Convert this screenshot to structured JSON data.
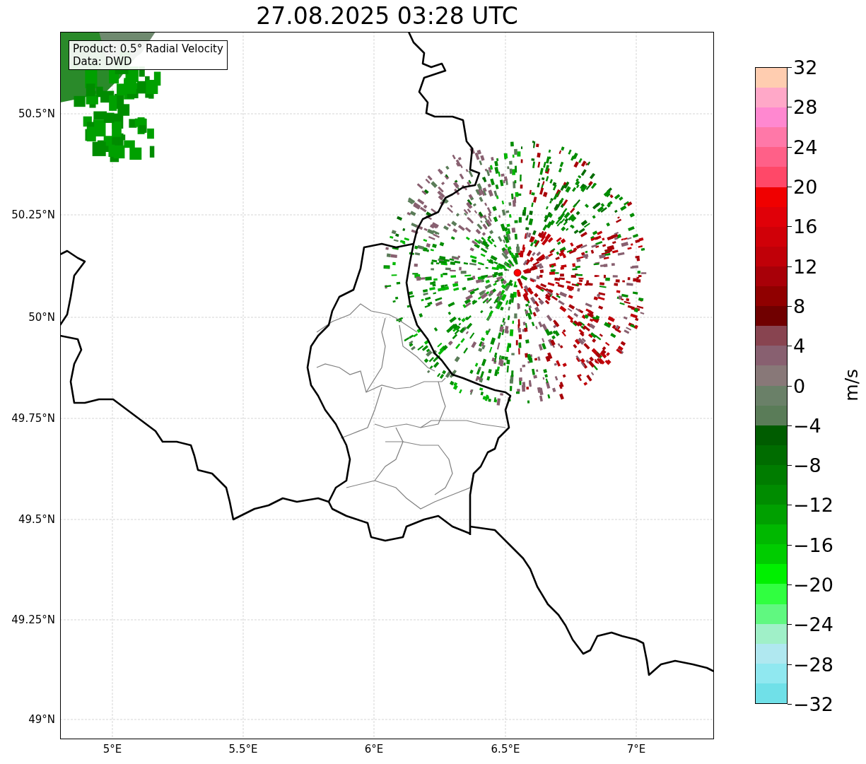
{
  "title": "27.08.2025 03:28 UTC",
  "info_box": {
    "lines": [
      "Product: 0.5° Radial Velocity",
      "Data: DWD"
    ]
  },
  "x_ticks": [
    "5°E",
    "5.5°E",
    "6°E",
    "6.5°E",
    "7°E"
  ],
  "y_ticks": [
    "50.5°N",
    "50.25°N",
    "50°N",
    "49.75°N",
    "49.5°N",
    "49.25°N",
    "49°N"
  ],
  "colorbar": {
    "label": "m/s",
    "ticks": [
      "32",
      "28",
      "24",
      "20",
      "16",
      "12",
      "8",
      "4",
      "0",
      "−4",
      "−8",
      "−12",
      "−16",
      "−20",
      "−24",
      "−28",
      "−32"
    ],
    "bins": [
      {
        "color": "#ffcdb0"
      },
      {
        "color": "#ffa8c8"
      },
      {
        "color": "#ff88d0"
      },
      {
        "color": "#ff78a8"
      },
      {
        "color": "#ff6088"
      },
      {
        "color": "#ff4868"
      },
      {
        "color": "#f00000"
      },
      {
        "color": "#e00008"
      },
      {
        "color": "#d00008"
      },
      {
        "color": "#c00008"
      },
      {
        "color": "#a80008"
      },
      {
        "color": "#900000"
      },
      {
        "color": "#700000"
      },
      {
        "color": "#884450"
      },
      {
        "color": "#886070"
      },
      {
        "color": "#887878"
      },
      {
        "color": "#6a8068"
      },
      {
        "color": "#5a7c58"
      },
      {
        "color": "#005c00"
      },
      {
        "color": "#006c00"
      },
      {
        "color": "#007c00"
      },
      {
        "color": "#008c00"
      },
      {
        "color": "#00a000"
      },
      {
        "color": "#00b800"
      },
      {
        "color": "#00cc00"
      },
      {
        "color": "#00f000"
      },
      {
        "color": "#30ff40"
      },
      {
        "color": "#60f880"
      },
      {
        "color": "#a0f0c8"
      },
      {
        "color": "#b0e8f0"
      },
      {
        "color": "#90e8f0"
      },
      {
        "color": "#70e0e8"
      }
    ]
  }
}
